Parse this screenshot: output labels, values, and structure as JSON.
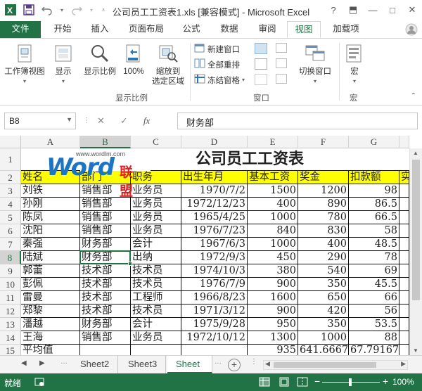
{
  "window": {
    "title": "公司员工工资表1.xls  [兼容模式] - Microsoft Excel",
    "help": "?",
    "ribbon_display": "⬒",
    "minimize": "—",
    "maximize": "□",
    "close": "✕"
  },
  "tabs": [
    {
      "label": "文件"
    },
    {
      "label": "开始"
    },
    {
      "label": "插入"
    },
    {
      "label": "页面布局"
    },
    {
      "label": "公式"
    },
    {
      "label": "数据"
    },
    {
      "label": "审阅"
    },
    {
      "label": "视图",
      "active": true
    },
    {
      "label": "加载项"
    }
  ],
  "login": "登录",
  "ribbon": {
    "workbook_views": "工作簿视图",
    "show": "显示",
    "zoom": "显示比例",
    "zoom100": "100%",
    "zoom_to_selection_1": "缩放到",
    "zoom_to_selection_2": "选定区域",
    "new_window": "新建窗口",
    "arrange_all": "全部重排",
    "freeze_panes": "冻结窗格",
    "switch_windows": "切换窗口",
    "macros": "宏",
    "group_zoom": "显示比例",
    "group_window": "窗口",
    "group_macros": "宏"
  },
  "formula_bar": {
    "name_box": "B8",
    "cancel": "✕",
    "enter": "✓",
    "fx": "fx",
    "value": "财务部"
  },
  "columns": [
    "A",
    "B",
    "C",
    "D",
    "E",
    "F",
    "G"
  ],
  "selected_column": "B",
  "selected_row": "8",
  "rows": [
    "1",
    "2",
    "3",
    "4",
    "5",
    "6",
    "7",
    "8",
    "9",
    "10",
    "11",
    "12",
    "13",
    "14",
    "15"
  ],
  "sheet_title": "公司员工工资表",
  "logo": {
    "word": "Word",
    "cn": "联盟",
    "url": "www.wordlm.com"
  },
  "header_row": [
    "姓名",
    "部门",
    "职务",
    "出生年月",
    "基本工资",
    "奖金",
    "扣款额",
    "实"
  ],
  "data_rows": [
    [
      "刘铁",
      "销售部",
      "业务员",
      "1970/7/2",
      "1500",
      "1200",
      "98"
    ],
    [
      "孙刚",
      "销售部",
      "业务员",
      "1972/12/23",
      "400",
      "890",
      "86.5"
    ],
    [
      "陈凤",
      "销售部",
      "业务员",
      "1965/4/25",
      "1000",
      "780",
      "66.5"
    ],
    [
      "沈阳",
      "销售部",
      "业务员",
      "1976/7/23",
      "840",
      "830",
      "58"
    ],
    [
      "秦强",
      "财务部",
      "会计",
      "1967/6/3",
      "1000",
      "400",
      "48.5"
    ],
    [
      "陆斌",
      "财务部",
      "出纳",
      "1972/9/3",
      "450",
      "290",
      "78"
    ],
    [
      "郭蕾",
      "技术部",
      "技术员",
      "1974/10/3",
      "380",
      "540",
      "69"
    ],
    [
      "彭佩",
      "技术部",
      "技术员",
      "1976/7/9",
      "900",
      "350",
      "45.5"
    ],
    [
      "雷曼",
      "技术部",
      "工程师",
      "1966/8/23",
      "1600",
      "650",
      "66"
    ],
    [
      "郑黎",
      "技术部",
      "技术员",
      "1971/3/12",
      "900",
      "420",
      "56"
    ],
    [
      "潘越",
      "财务部",
      "会计",
      "1975/9/28",
      "950",
      "350",
      "53.5"
    ],
    [
      "王海",
      "销售部",
      "业务员",
      "1972/10/12",
      "1300",
      "1000",
      "88"
    ],
    [
      "平均值",
      "",
      "",
      "",
      "935",
      "641.6667",
      "67.79167"
    ]
  ],
  "sheets": [
    "Sheet2",
    "Sheet3",
    "Sheet1"
  ],
  "active_sheet": "Sheet1",
  "sheet_display": [
    "Sheet2",
    "Sheet3",
    "Sheet"
  ],
  "status": {
    "ready": "就绪",
    "zoom_minus": "−",
    "zoom_plus": "+",
    "zoom": "100%"
  },
  "colors": {
    "accent": "#217346",
    "header_fill": "#ffff00"
  }
}
